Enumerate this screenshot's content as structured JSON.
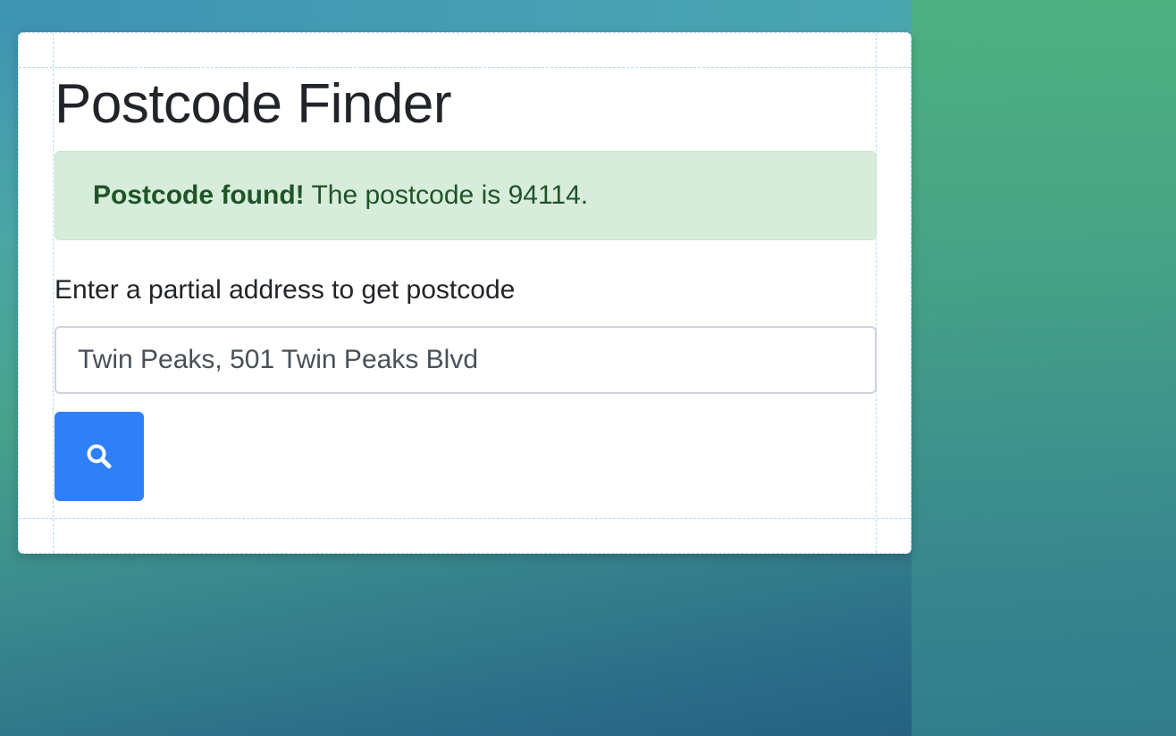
{
  "page": {
    "title": "Postcode Finder"
  },
  "alert": {
    "bold_text": "Postcode found!",
    "message": "The postcode is 94114.",
    "color": "#d8ecdc"
  },
  "form": {
    "label": "Enter a partial address to get postcode",
    "address_value": "Twin Peaks, 501 Twin Peaks Blvd",
    "search_button_icon": "search-icon",
    "accent_color": "#2f80f8"
  }
}
